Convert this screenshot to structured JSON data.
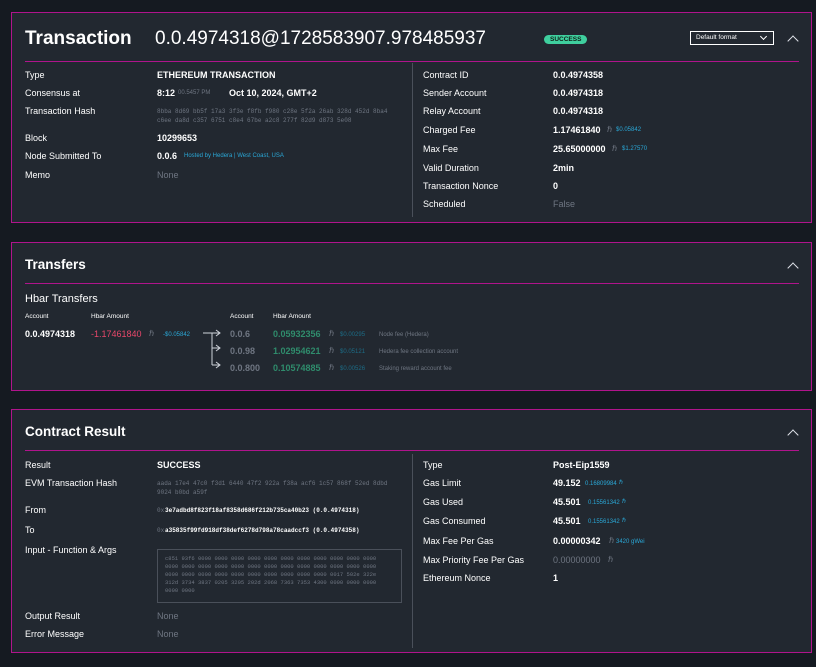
{
  "transaction": {
    "title": "Transaction",
    "id": "0.0.4974318@1728583907.978485937",
    "status_badge": "SUCCESS",
    "format_select": "Default format",
    "left": {
      "type_label": "Type",
      "type_value": "ETHEREUM TRANSACTION",
      "consensus_label": "Consensus at",
      "consensus_time": "8:12",
      "consensus_seconds": "00.5457 PM",
      "consensus_date": "Oct 10, 2024, GMT+2",
      "hash_label": "Transaction Hash",
      "hash_line1": "8bba 8d69 bb5f 17a3 3f3e f8fb f980 c28e 5f2a 26ab 328d 452d 8ba4",
      "hash_line2": "c6ee da8d c357 6751 c8e4 67be a2c8 277f 82d9 d873 5e08",
      "block_label": "Block",
      "block_value": "10299653",
      "node_label": "Node Submitted To",
      "node_value": "0.0.6",
      "node_desc": "Hosted by Hedera | West Coast, USA",
      "memo_label": "Memo",
      "memo_value": "None"
    },
    "right": {
      "contract_label": "Contract ID",
      "contract_value": "0.0.4974358",
      "sender_label": "Sender Account",
      "sender_value": "0.0.4974318",
      "relay_label": "Relay Account",
      "relay_value": "0.0.4974318",
      "charged_label": "Charged Fee",
      "charged_value": "1.17461840",
      "charged_usd": "$0.05842",
      "maxfee_label": "Max Fee",
      "maxfee_value": "25.65000000",
      "maxfee_usd": "$1.27570",
      "valid_label": "Valid Duration",
      "valid_value": "2min",
      "nonce_label": "Transaction Nonce",
      "nonce_value": "0",
      "scheduled_label": "Scheduled",
      "scheduled_value": "False"
    }
  },
  "transfers": {
    "title": "Transfers",
    "subtitle": "Hbar Transfers",
    "col_account": "Account",
    "col_amount": "Hbar Amount",
    "col_account2": "Account",
    "col_amount2": "Hbar Amount",
    "source": {
      "account": "0.0.4974318",
      "amount": "-1.17461840",
      "usd": "-$0.05842"
    },
    "rows": [
      {
        "account": "0.0.6",
        "amount": "0.05932356",
        "usd": "$0.00295",
        "desc": "Node fee (Hedera)"
      },
      {
        "account": "0.0.98",
        "amount": "1.02954621",
        "usd": "$0.05121",
        "desc": "Hedera fee collection account"
      },
      {
        "account": "0.0.800",
        "amount": "0.10574885",
        "usd": "$0.00526",
        "desc": "Staking reward account fee"
      }
    ]
  },
  "contract": {
    "title": "Contract Result",
    "left": {
      "result_label": "Result",
      "result_value": "SUCCESS",
      "evm_label": "EVM Transaction Hash",
      "evm_line1": "aada 17e4 47c0 f3d1 6440 47f2 922a f38a acf6 1c57 868f 52ed 8dbd",
      "evm_line2": "9024 b0bd a59f",
      "from_label": "From",
      "from_prefix": "0x",
      "from_value": "3e7adbd8f823f18af8358d686f212b735ca40b23 (0.0.4974318)",
      "to_label": "To",
      "to_prefix": "0x",
      "to_value": "a35835f99fd918df38def6278d798a78caadccf3 (0.0.4974358)",
      "input_label": "Input - Function & Args",
      "input_lines": [
        "c851 93f6 0000 0000 0000 0000 0000 0000 0000 0000 0000 0000 0000",
        "0000 0000 0000 0000 0000 0000 0000 0000 0000 0000 0000 0000 0000",
        "0000 0000 0000 0000 0000 0000 0000 0000 0000 0000 0017 502e 322e",
        "312d 3734 3837 0205 3205 202d 2068 7363 7353 4300 0000 0000 0000",
        "0000 0000"
      ],
      "output_label": "Output Result",
      "output_value": "None",
      "error_label": "Error Message",
      "error_value": "None"
    },
    "right": {
      "type_label": "Type",
      "type_value": "Post-Eip1559",
      "gaslimit_label": "Gas Limit",
      "gaslimit_value": "49.152",
      "gaslimit_extra": "0.16809984",
      "gasused_label": "Gas Used",
      "gasused_value": "45.501",
      "gasused_extra": "0.15561342",
      "gascons_label": "Gas Consumed",
      "gascons_value": "45.501",
      "gascons_extra": "0.15561342",
      "maxfeegas_label": "Max Fee Per Gas",
      "maxfeegas_value": "0.00000342",
      "maxfeegas_extra": "3420 gWei",
      "maxprio_label": "Max Priority Fee Per Gas",
      "maxprio_value": "0.00000000",
      "ethnonce_label": "Ethereum Nonce",
      "ethnonce_value": "1"
    }
  },
  "colors": {
    "accent": "#b0148c",
    "badge": "#3fcf9e",
    "link": "#2aa7d6",
    "card_bg": "#222830",
    "page_bg": "#151a21"
  }
}
